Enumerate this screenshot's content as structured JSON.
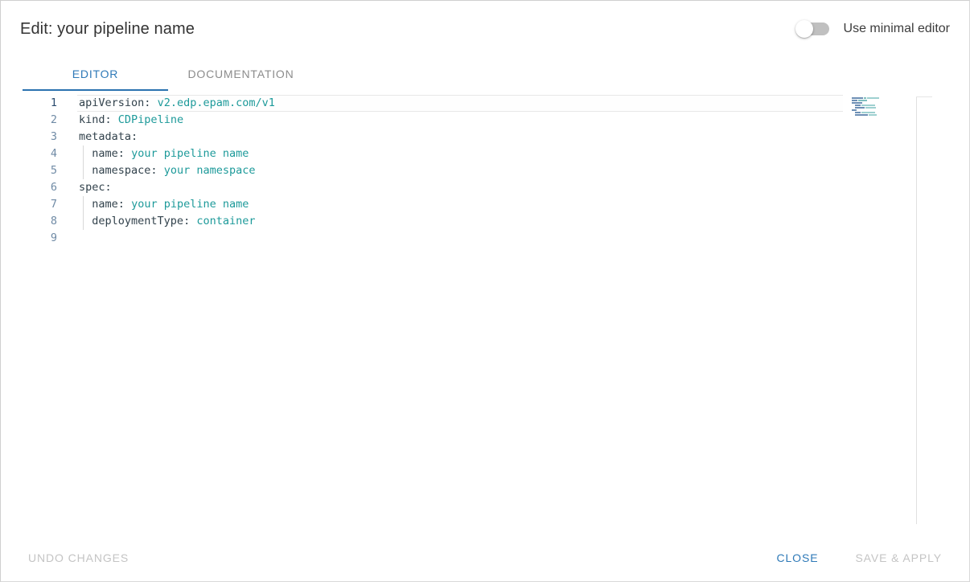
{
  "dialog": {
    "title": "Edit: your pipeline name"
  },
  "header": {
    "minimal_editor_toggle_label": "Use minimal editor",
    "minimal_editor_toggle_state": "off"
  },
  "tabs": [
    {
      "label": "EDITOR",
      "active": true
    },
    {
      "label": "DOCUMENTATION",
      "active": false
    }
  ],
  "editor": {
    "language": "yaml",
    "active_line": 1,
    "lines": [
      {
        "number": "1",
        "key": "apiVersion",
        "sep": ":",
        "value": "v2.edp.epam.com/v1",
        "indent": 0,
        "text": "apiVersion: v2.edp.epam.com/v1"
      },
      {
        "number": "2",
        "key": "kind",
        "sep": ":",
        "value": "CDPipeline",
        "indent": 0,
        "text": "kind: CDPipeline"
      },
      {
        "number": "3",
        "key": "metadata",
        "sep": ":",
        "value": "",
        "indent": 0,
        "text": "metadata:"
      },
      {
        "number": "4",
        "key": "name",
        "sep": ":",
        "value": "your pipeline name",
        "indent": 1,
        "text": "  name: your pipeline name"
      },
      {
        "number": "5",
        "key": "namespace",
        "sep": ":",
        "value": "your namespace",
        "indent": 1,
        "text": "  namespace: your namespace"
      },
      {
        "number": "6",
        "key": "spec",
        "sep": ":",
        "value": "",
        "indent": 0,
        "text": "spec:"
      },
      {
        "number": "7",
        "key": "name",
        "sep": ":",
        "value": "your pipeline name",
        "indent": 1,
        "text": "  name: your pipeline name"
      },
      {
        "number": "8",
        "key": "deploymentType",
        "sep": ":",
        "value": "container",
        "indent": 1,
        "text": "  deploymentType: container"
      },
      {
        "number": "9",
        "key": "",
        "sep": "",
        "value": "",
        "indent": 0,
        "text": ""
      }
    ],
    "colors": {
      "key": "#32424c",
      "value": "#1d9a9a",
      "line_number": "#6f8aa5",
      "background": "#ffffff",
      "indent_guide": "#d8d8d8"
    }
  },
  "footer": {
    "undo_label": "UNDO CHANGES",
    "undo_disabled": true,
    "close_label": "CLOSE",
    "close_disabled": false,
    "save_label": "SAVE & APPLY",
    "save_disabled": true
  },
  "theme": {
    "accent": "#2f7ab8",
    "tab_underline": "#2b72b0",
    "title": "#333333",
    "disabled_text": "#c4c4c4"
  }
}
